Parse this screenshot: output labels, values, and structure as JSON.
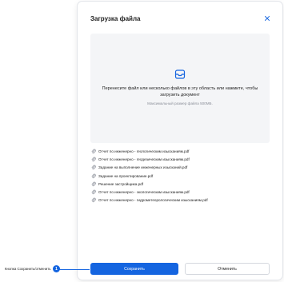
{
  "modal": {
    "title": "Загрузка файла",
    "dropzone": {
      "text": "Перенесите файл или несколько файлов в эту область или нажмите, чтобы загрузить документ",
      "subtext": "Максимальный размер файла 500МБ."
    },
    "files": [
      "Отчет по инженерно - геологическим изысканиям.pdf",
      "Отчет по инженерно - геодезическим изысканиям.pdf",
      "Задание на выполнение инженерных изысканий.pdf",
      "Задание на проектирование.pdf",
      "Решение застройщика.pdf",
      "Отчет по инженерно - экологическим изысканиям.pdf",
      "Отчет по инженерно - гидрометеорологическим изысканиям.pdf"
    ],
    "save_label": "Сохранить",
    "cancel_label": "Отменить"
  },
  "callout": {
    "label": "Кнопка Сохранить/отменить",
    "number": "1"
  },
  "icons": {
    "close": "close-icon",
    "upload": "inbox-upload-icon",
    "attachment": "paperclip-icon"
  },
  "colors": {
    "accent": "#1565e0",
    "dropzone_bg": "#f4f5f7"
  }
}
